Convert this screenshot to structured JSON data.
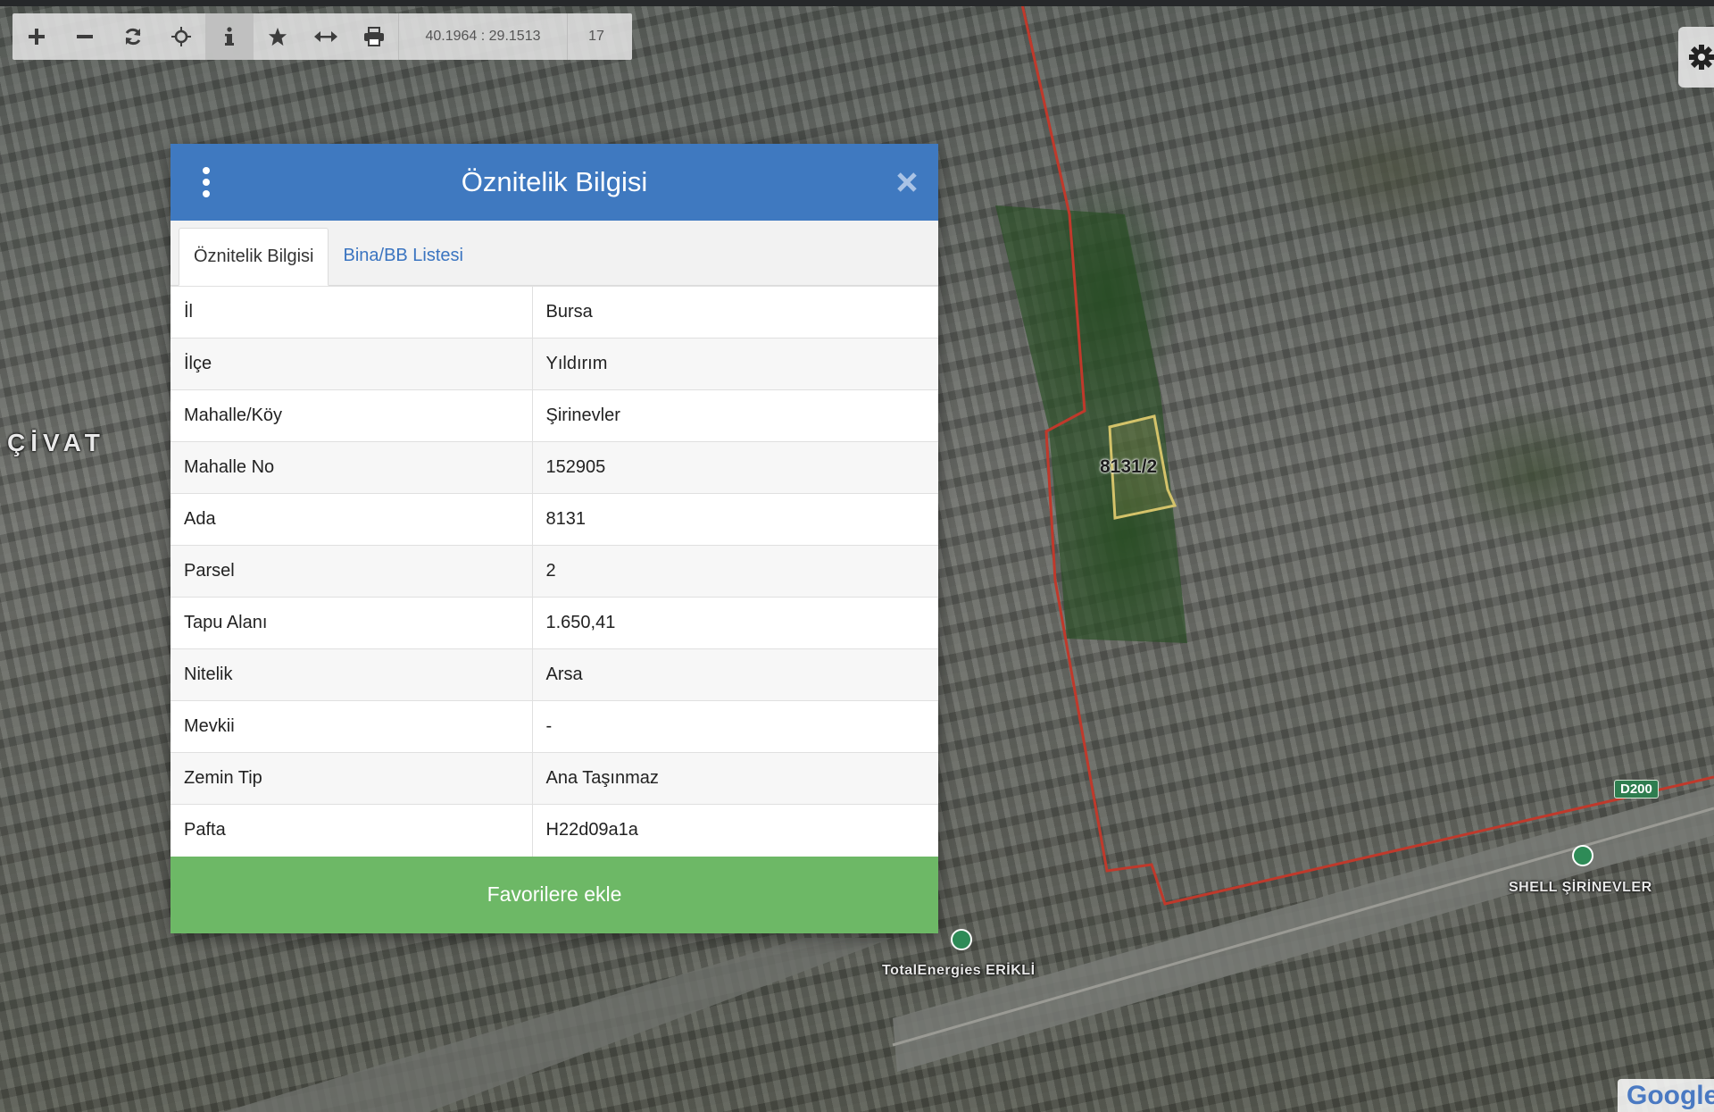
{
  "toolbar": {
    "buttons": [
      {
        "name": "zoom-in",
        "icon": "plus-icon"
      },
      {
        "name": "zoom-out",
        "icon": "minus-icon"
      },
      {
        "name": "refresh",
        "icon": "refresh-icon"
      },
      {
        "name": "locate",
        "icon": "crosshair-icon"
      },
      {
        "name": "info",
        "icon": "info-icon"
      },
      {
        "name": "favorites",
        "icon": "star-icon"
      },
      {
        "name": "measure",
        "icon": "horizontal-arrows-icon"
      },
      {
        "name": "print",
        "icon": "print-icon"
      }
    ],
    "coordinates": "40.1964 : 29.1513",
    "zoom_level": "17"
  },
  "map": {
    "parcel_label": "8131/2",
    "place_labels": {
      "district": "ÇİVAT",
      "gas_station_1": "TotalEnergies ERİKLİ",
      "gas_station_2": "SHELL ŞİRİNEVLER"
    },
    "road_badge": "D200",
    "provider_logo": "Google",
    "colors": {
      "boundary_line": "#c0392b",
      "parcel_outline": "#d4c36a"
    }
  },
  "dialog": {
    "title": "Öznitelik Bilgisi",
    "tabs": [
      {
        "label": "Öznitelik Bilgisi",
        "active": true
      },
      {
        "label": "Bina/BB Listesi",
        "active": false
      }
    ],
    "rows": [
      {
        "key": "İl",
        "value": "Bursa"
      },
      {
        "key": "İlçe",
        "value": "Yıldırım"
      },
      {
        "key": "Mahalle/Köy",
        "value": "Şirinevler"
      },
      {
        "key": "Mahalle No",
        "value": "152905"
      },
      {
        "key": "Ada",
        "value": "8131"
      },
      {
        "key": "Parsel",
        "value": "2"
      },
      {
        "key": "Tapu Alanı",
        "value": "1.650,41"
      },
      {
        "key": "Nitelik",
        "value": "Arsa"
      },
      {
        "key": "Mevkii",
        "value": "-"
      },
      {
        "key": "Zemin Tip",
        "value": "Ana Taşınmaz"
      },
      {
        "key": "Pafta",
        "value": "H22d09a1a"
      }
    ],
    "favorite_button": "Favorilere ekle",
    "colors": {
      "header": "#3f79c0",
      "tab_link": "#3a74c0",
      "favorite_button": "#6db866"
    }
  }
}
